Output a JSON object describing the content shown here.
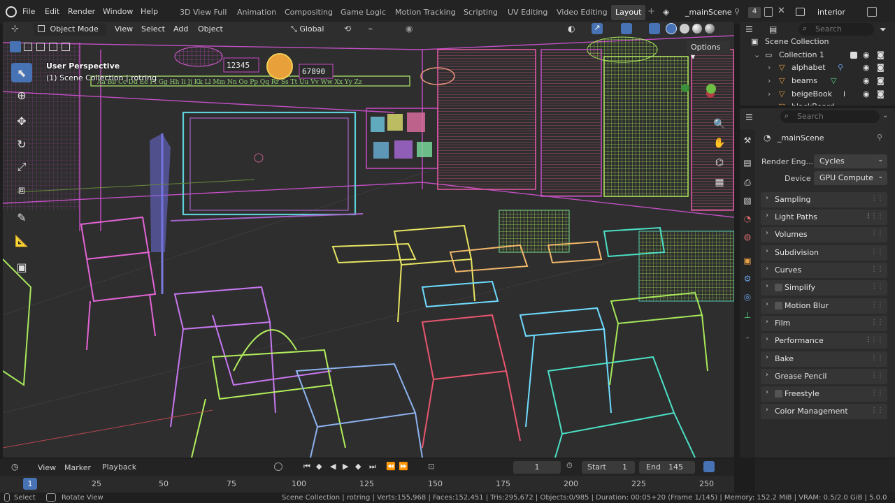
{
  "menu": [
    "File",
    "Edit",
    "Render",
    "Window",
    "Help"
  ],
  "workspaces": [
    "3D View Full",
    "Animation",
    "Compositing",
    "Game Logic",
    "Motion Tracking",
    "Scripting",
    "UV Editing",
    "Video Editing",
    "Layout"
  ],
  "active_workspace": "Layout",
  "scene_name": "_mainScene",
  "scene_users": "4",
  "view_layer": "interior",
  "viewport": {
    "mode": "Object Mode",
    "menus": [
      "View",
      "Select",
      "Add",
      "Object"
    ],
    "orientation": "Global",
    "overlay_title": "User Perspective",
    "overlay_subtitle": "(1) Scene Collection | rotring",
    "options_label": "Options"
  },
  "outliner": {
    "search_placeholder": "Search",
    "root": "Scene Collection",
    "collection": "Collection 1",
    "items": [
      "alphabet",
      "beams",
      "beigeBook",
      "blackBoard"
    ]
  },
  "properties": {
    "search_placeholder": "Search",
    "scene": "_mainScene",
    "render_engine_label": "Render Eng...",
    "render_engine_value": "Cycles",
    "device_label": "Device",
    "device_value": "GPU Compute",
    "panels": [
      "Sampling",
      "Light Paths",
      "Volumes",
      "Subdivision",
      "Curves",
      "Simplify",
      "Motion Blur",
      "Film",
      "Performance",
      "Bake",
      "Grease Pencil",
      "Freestyle",
      "Color Management"
    ]
  },
  "timeline": {
    "menus": [
      "View",
      "Marker",
      "Playback"
    ],
    "current_frame": "1",
    "start_label": "Start",
    "start_value": "1",
    "end_label": "End",
    "end_value": "145",
    "ticks": [
      "1",
      "25",
      "50",
      "75",
      "100",
      "125",
      "150",
      "175",
      "200",
      "225",
      "250"
    ]
  },
  "status": {
    "left1": "Select",
    "left2": "Rotate View",
    "stats": "Scene Collection | rotring | Verts:155,968 | Faces:152,451 | Tris:295,672 | Objects:0/985 | Duration: 00:05+20 (Frame 1/145) | Memory: 152.2 MiB | VRAM: 0.5/2.0 GiB | 5.0.0"
  },
  "viewport_labels": {
    "counter_left": "12345",
    "counter_right": "67890",
    "alphabet_strip": "Aa Bb Cc Dd Ee Ff Gg Hh Ii Jj Kk Ll Mm Nn Oo Pp Qq Rr Ss Tt Uu Vv Ww Xx Yy Zz"
  }
}
